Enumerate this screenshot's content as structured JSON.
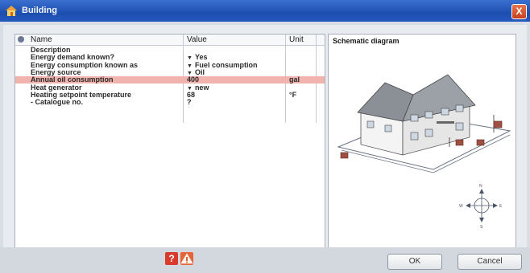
{
  "window": {
    "title": "Building",
    "close_label": "X"
  },
  "grid": {
    "headers": {
      "name": "Name",
      "value": "Value",
      "unit": "Unit"
    },
    "rows": [
      {
        "name": "Description",
        "value": "",
        "unit": "",
        "dropdown": false,
        "selected": false
      },
      {
        "name": "Energy demand known?",
        "value": "Yes",
        "unit": "",
        "dropdown": true,
        "selected": false
      },
      {
        "name": "Energy consumption known as",
        "value": "Fuel consumption",
        "unit": "",
        "dropdown": true,
        "selected": false
      },
      {
        "name": "Energy source",
        "value": "Oil",
        "unit": "",
        "dropdown": true,
        "selected": false
      },
      {
        "name": "Annual oil consumption",
        "value": "400",
        "unit": "gal",
        "dropdown": false,
        "selected": true
      },
      {
        "name": "Heat generator",
        "value": "new",
        "unit": "",
        "dropdown": true,
        "selected": false
      },
      {
        "name": "Heating setpoint temperature",
        "value": "68",
        "unit": "°F",
        "dropdown": false,
        "selected": false
      },
      {
        "name": "- Catalogue no.",
        "value": "?",
        "unit": "",
        "dropdown": false,
        "selected": false
      }
    ]
  },
  "schematic": {
    "title": "Schematic diagram",
    "compass": {
      "n": "N",
      "s": "S",
      "e": "E",
      "w": "W"
    }
  },
  "buttons": {
    "ok": "OK",
    "cancel": "Cancel",
    "help": "?"
  }
}
